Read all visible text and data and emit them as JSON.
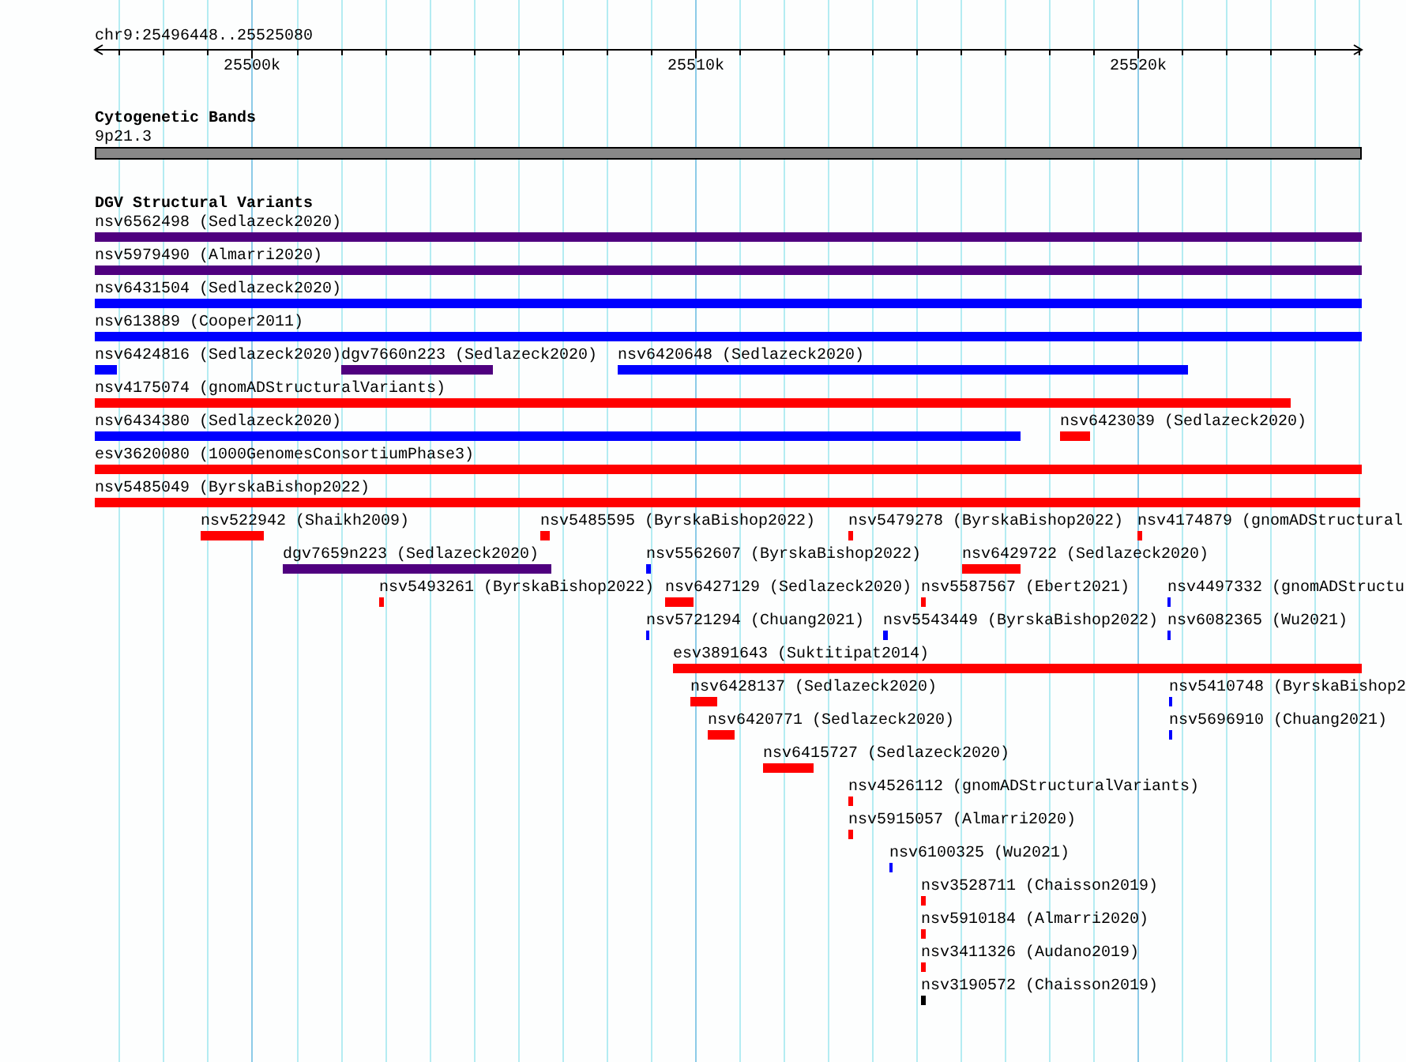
{
  "axis": {
    "title": "chr9:25496448..25525080",
    "ticks": [
      {
        "label": "25500k"
      },
      {
        "label": "25510k"
      },
      {
        "label": "25520k"
      }
    ]
  },
  "cytogenetic_bands": {
    "title": "Cytogenetic Bands",
    "bands": [
      {
        "name": "9p21.3"
      }
    ]
  },
  "dgv_track": {
    "title": "DGV Structural Variants",
    "rows": [
      [
        {
          "label": "nsv6562498 (Sedlazeck2020)",
          "color": "#4f007f"
        }
      ],
      [
        {
          "label": "nsv5979490 (Almarri2020)",
          "color": "#4f007f"
        }
      ],
      [
        {
          "label": "nsv6431504 (Sedlazeck2020)",
          "color": "#0000ff"
        }
      ],
      [
        {
          "label": "nsv613889 (Cooper2011)",
          "color": "#0000ff"
        }
      ],
      [
        {
          "label": "nsv6424816 (Sedlazeck2020)",
          "color": "#0000ff"
        },
        {
          "label": "dgv7660n223 (Sedlazeck2020)",
          "color": "#4f007f"
        },
        {
          "label": "nsv6420648 (Sedlazeck2020)",
          "color": "#0000ff"
        }
      ],
      [
        {
          "label": "nsv4175074 (gnomADStructuralVariants)",
          "color": "#ff0000"
        }
      ],
      [
        {
          "label": "nsv6434380 (Sedlazeck2020)",
          "color": "#0000ff"
        },
        {
          "label": "nsv6423039 (Sedlazeck2020)",
          "color": "#ff0000"
        }
      ],
      [
        {
          "label": "esv3620080 (1000GenomesConsortiumPhase3)",
          "color": "#ff0000"
        }
      ],
      [
        {
          "label": "nsv5485049 (ByrskaBishop2022)",
          "color": "#ff0000"
        }
      ],
      [
        {
          "label": "nsv522942 (Shaikh2009)",
          "color": "#ff0000"
        },
        {
          "label": "nsv5485595 (ByrskaBishop2022)",
          "color": "#ff0000"
        },
        {
          "label": "nsv5479278 (ByrskaBishop2022)",
          "color": "#ff0000"
        },
        {
          "label": "nsv4174879 (gnomADStructural",
          "color": "#ff0000"
        }
      ],
      [
        {
          "label": "dgv7659n223 (Sedlazeck2020)",
          "color": "#4f007f"
        },
        {
          "label": "nsv5562607 (ByrskaBishop2022)",
          "color": "#0000ff"
        },
        {
          "label": "nsv6429722 (Sedlazeck2020)",
          "color": "#ff0000"
        }
      ],
      [
        {
          "label": "nsv5493261 (ByrskaBishop2022)",
          "color": "#ff0000"
        },
        {
          "label": "nsv6427129 (Sedlazeck2020)",
          "color": "#ff0000"
        },
        {
          "label": "nsv5587567 (Ebert2021)",
          "color": "#ff0000"
        },
        {
          "label": "nsv4497332 (gnomADStructu",
          "color": "#0000ff"
        }
      ],
      [
        {
          "label": "nsv5721294 (Chuang2021)",
          "color": "#0000ff"
        },
        {
          "label": "nsv5543449 (ByrskaBishop2022)",
          "color": "#0000ff"
        },
        {
          "label": "nsv6082365 (Wu2021)",
          "color": "#0000ff"
        }
      ],
      [
        {
          "label": "esv3891643 (Suktitipat2014)",
          "color": "#ff0000"
        }
      ],
      [
        {
          "label": "nsv6428137 (Sedlazeck2020)",
          "color": "#ff0000"
        },
        {
          "label": "nsv5410748 (ByrskaBishop2",
          "color": "#0000ff"
        }
      ],
      [
        {
          "label": "nsv6420771 (Sedlazeck2020)",
          "color": "#ff0000"
        },
        {
          "label": "nsv5696910 (Chuang2021)",
          "color": "#0000ff"
        }
      ],
      [
        {
          "label": "nsv6415727 (Sedlazeck2020)",
          "color": "#ff0000"
        }
      ],
      [
        {
          "label": "nsv4526112 (gnomADStructuralVariants)",
          "color": "#ff0000"
        }
      ],
      [
        {
          "label": "nsv5915057 (Almarri2020)",
          "color": "#ff0000"
        }
      ],
      [
        {
          "label": "nsv6100325 (Wu2021)",
          "color": "#0000ff"
        }
      ],
      [
        {
          "label": "nsv3528711 (Chaisson2019)",
          "color": "#ff0000"
        }
      ],
      [
        {
          "label": "nsv5910184 (Almarri2020)",
          "color": "#ff0000"
        }
      ],
      [
        {
          "label": "nsv3411326 (Audano2019)",
          "color": "#ff0000"
        }
      ],
      [
        {
          "label": "nsv3190572 (Chaisson2019)",
          "color": "#000000"
        }
      ]
    ]
  }
}
